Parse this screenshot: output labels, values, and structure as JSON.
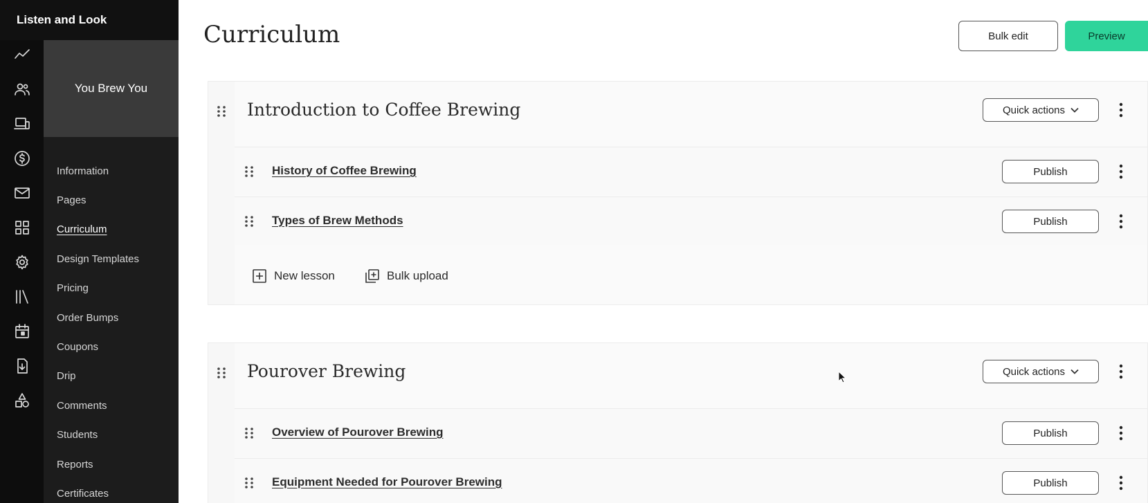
{
  "app": {
    "school_name": "Listen and Look"
  },
  "product": {
    "name": "You Brew You"
  },
  "rail_icons": [
    "analytics-icon",
    "users-icon",
    "devices-icon",
    "dollar-icon",
    "mail-icon",
    "grid-icon",
    "gear-icon",
    "library-icon",
    "calendar-icon",
    "download-icon",
    "shapes-icon"
  ],
  "nav": {
    "items": [
      {
        "label": "Information"
      },
      {
        "label": "Pages"
      },
      {
        "label": "Curriculum",
        "active": true
      },
      {
        "label": "Design Templates"
      },
      {
        "label": "Pricing"
      },
      {
        "label": "Order Bumps"
      },
      {
        "label": "Coupons"
      },
      {
        "label": "Drip"
      },
      {
        "label": "Comments"
      },
      {
        "label": "Students"
      },
      {
        "label": "Reports"
      },
      {
        "label": "Certificates"
      }
    ]
  },
  "header": {
    "title": "Curriculum",
    "bulk_edit_label": "Bulk edit",
    "preview_label": "Preview"
  },
  "modules": [
    {
      "title": "Introduction to Coffee Brewing",
      "quick_actions_label": "Quick actions",
      "lessons": [
        {
          "title": "History of Coffee Brewing",
          "publish_label": "Publish"
        },
        {
          "title": "Types of Brew Methods",
          "publish_label": "Publish"
        }
      ],
      "new_lesson_label": "New lesson",
      "bulk_upload_label": "Bulk upload"
    },
    {
      "title": "Pourover Brewing",
      "quick_actions_label": "Quick actions",
      "lessons": [
        {
          "title": "Overview of Pourover Brewing",
          "publish_label": "Publish"
        },
        {
          "title": "Equipment Needed for Pourover Brewing",
          "publish_label": "Publish"
        }
      ]
    }
  ],
  "colors": {
    "preview_button": "#2fd49b",
    "topbar": "#111111",
    "sidebar": "#1c1c1c",
    "product_card": "#3a3a3a"
  }
}
